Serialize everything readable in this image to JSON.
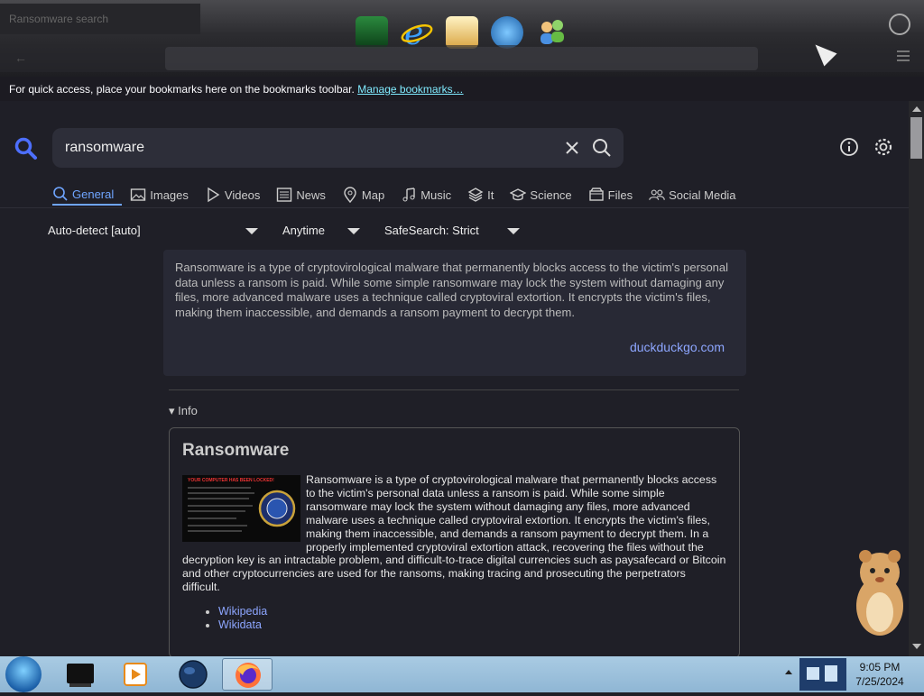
{
  "browser": {
    "tab_title": "Ransomware search",
    "bookmarks_hint": "For quick access, place your bookmarks here on the bookmarks toolbar.",
    "bookmarks_link": "Manage bookmarks…"
  },
  "search": {
    "query": "ransomware"
  },
  "tabs": [
    {
      "label": "General",
      "icon": "search-icon",
      "active": true
    },
    {
      "label": "Images",
      "icon": "image-icon"
    },
    {
      "label": "Videos",
      "icon": "play-icon"
    },
    {
      "label": "News",
      "icon": "newspaper-icon"
    },
    {
      "label": "Map",
      "icon": "map-pin-icon"
    },
    {
      "label": "Music",
      "icon": "music-note-icon"
    },
    {
      "label": "It",
      "icon": "layers-icon"
    },
    {
      "label": "Science",
      "icon": "graduation-cap-icon"
    },
    {
      "label": "Files",
      "icon": "files-icon"
    },
    {
      "label": "Social Media",
      "icon": "users-icon"
    }
  ],
  "filters": {
    "language": "Auto-detect [auto]",
    "time": "Anytime",
    "safesearch": "SafeSearch: Strict"
  },
  "answer": {
    "text": "Ransomware is a type of cryptovirological malware that permanently blocks access to the victim's personal data unless a ransom is paid. While some simple ransomware may lock the system without damaging any files, more advanced malware uses a technique called cryptoviral extortion. It encrypts the victim's files, making them inaccessible, and demands a ransom payment to decrypt them.",
    "source": "duckduckgo.com"
  },
  "info": {
    "toggle": "▾ Info",
    "title": "Ransomware",
    "image_caption": "YOUR COMPUTER HAS BEEN LOCKED!",
    "text": "Ransomware is a type of cryptovirological malware that permanently blocks access to the victim's personal data unless a ransom is paid. While some simple ransomware may lock the system without damaging any files, more advanced malware uses a technique called cryptoviral extortion. It encrypts the victim's files, making them inaccessible, and demands a ransom payment to decrypt them. In a properly implemented cryptoviral extortion attack, recovering the files without the decryption key is an intractable problem, and difficult-to-trace digital currencies such as paysafecard or Bitcoin and other cryptocurrencies are used for the ransoms, making tracing and prosecuting the perpetrators difficult.",
    "links": [
      "Wikipedia",
      "Wikidata"
    ]
  },
  "taskbar": {
    "time": "9:05 PM",
    "date": "7/25/2024"
  },
  "colors": {
    "accent": "#6fa5ff",
    "link": "#8da6ff",
    "page_bg": "#1f1f27"
  }
}
